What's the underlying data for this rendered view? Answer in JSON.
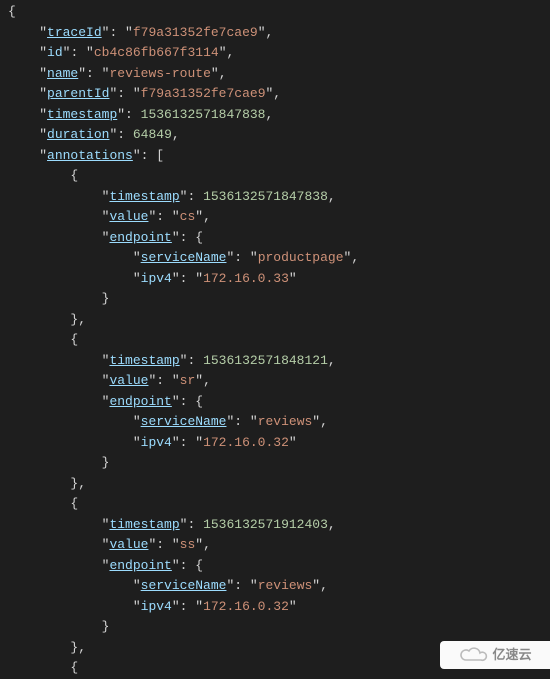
{
  "code": {
    "k_traceId": "traceId",
    "v_traceId": "f79a31352fe7cae9",
    "k_id": "id",
    "v_id": "cb4c86fb667f3114",
    "k_name": "name",
    "v_name": "reviews-route",
    "k_parentId": "parentId",
    "v_parentId": "f79a31352fe7cae9",
    "k_timestamp": "timestamp",
    "v_timestamp": "1536132571847838",
    "k_duration": "duration",
    "v_duration": "64849",
    "k_annotations": "annotations",
    "k_value": "value",
    "k_endpoint": "endpoint",
    "k_serviceName": "serviceName",
    "k_ipv4": "ipv4",
    "ann1_ts": "1536132571847838",
    "ann1_val": "cs",
    "ann1_service": "productpage",
    "ann1_ipv4": "172.16.0.33",
    "ann2_ts": "1536132571848121",
    "ann2_val": "sr",
    "ann2_service": "reviews",
    "ann2_ipv4": "172.16.0.32",
    "ann3_ts": "1536132571912403",
    "ann3_val": "ss",
    "ann3_service": "reviews",
    "ann3_ipv4": "172.16.0.32"
  },
  "watermark": {
    "text": "亿速云"
  }
}
